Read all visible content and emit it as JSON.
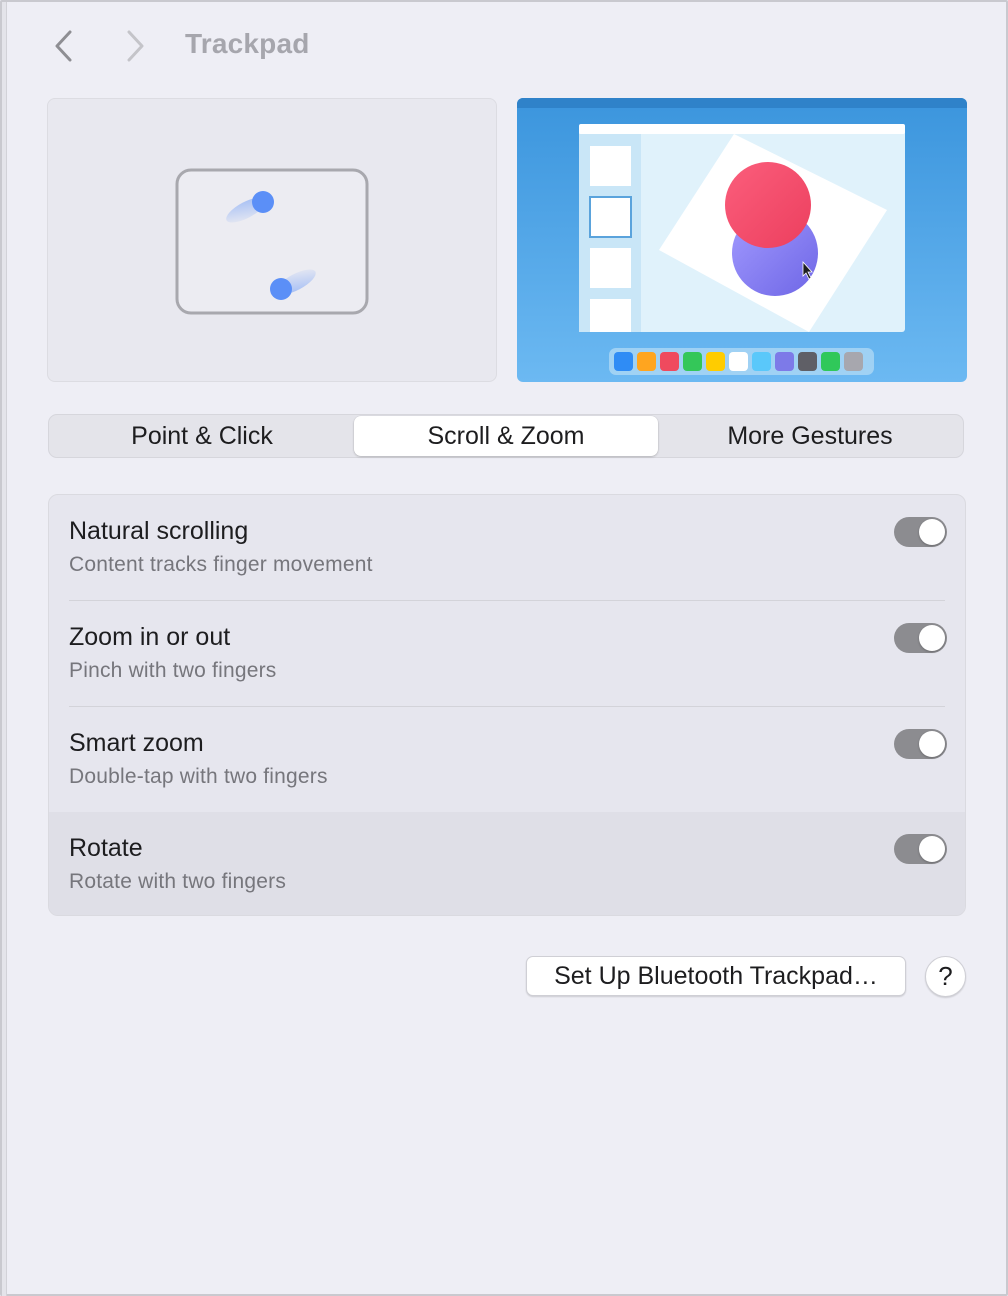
{
  "toolbar": {
    "title": "Trackpad"
  },
  "tabs": [
    {
      "label": "Point & Click",
      "selected": false
    },
    {
      "label": "Scroll & Zoom",
      "selected": true
    },
    {
      "label": "More Gestures",
      "selected": false
    }
  ],
  "settings": [
    {
      "title": "Natural scrolling",
      "subtitle": "Content tracks finger movement",
      "on": true
    },
    {
      "title": "Zoom in or out",
      "subtitle": "Pinch with two fingers",
      "on": true
    },
    {
      "title": "Smart zoom",
      "subtitle": "Double-tap with two fingers",
      "on": true
    },
    {
      "title": "Rotate",
      "subtitle": "Rotate with two fingers",
      "on": true
    }
  ],
  "buttons": {
    "setup_label": "Set Up Bluetooth Trackpad…",
    "help_label": "?"
  },
  "colors": {
    "accent_blue": "#5b8ff7",
    "toggle_track": "#8c8c90",
    "preview_background": "#4aa3e6",
    "red_circle": "#f04c6a",
    "purple_circle": "#7c74ea"
  },
  "dock_icon_colors": [
    "#2f8cf5",
    "#ffa51f",
    "#ef4a5e",
    "#34c759",
    "#ffcc00",
    "#ffffff",
    "#5ac8fa",
    "#7d7ae8",
    "#5f5f66",
    "#30c85a",
    "#a7a7ae"
  ]
}
